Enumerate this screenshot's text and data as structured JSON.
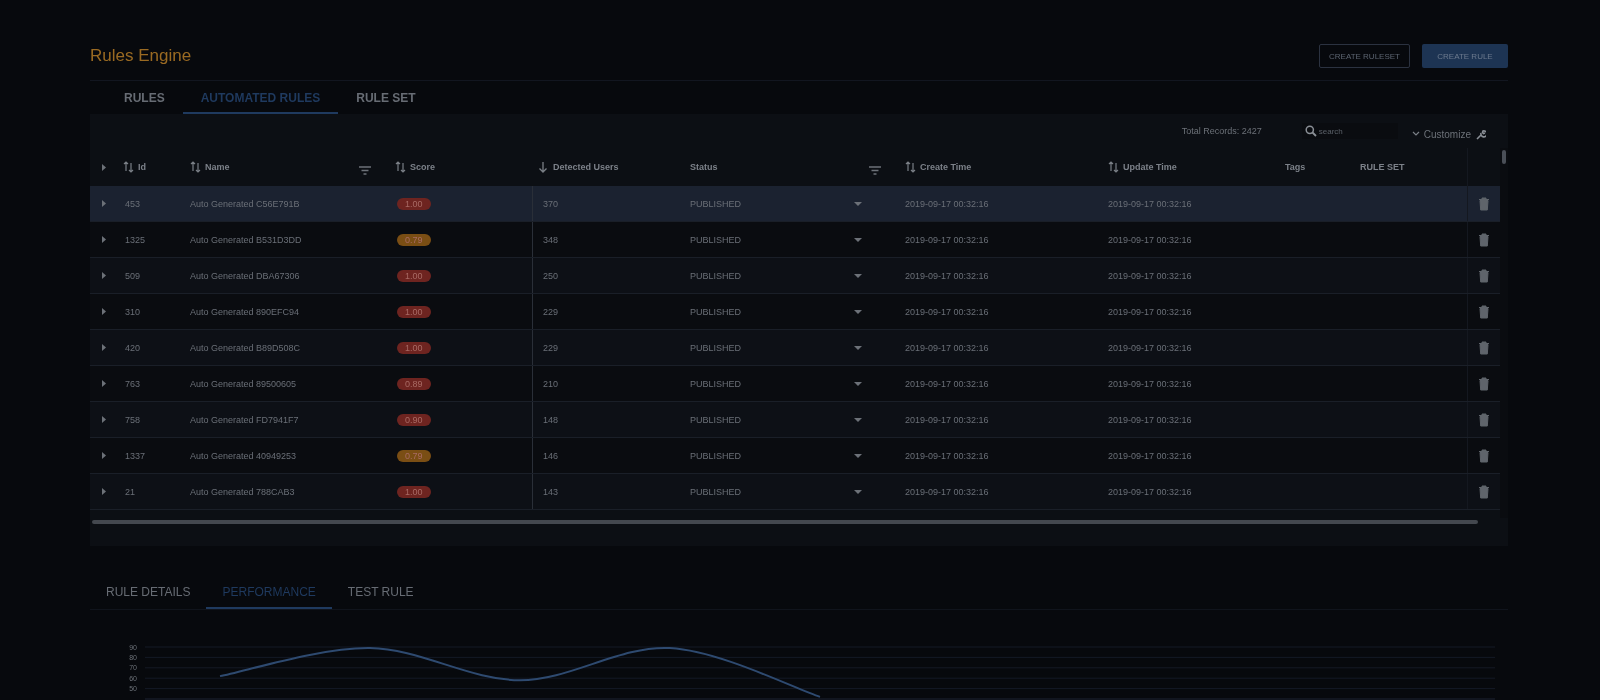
{
  "page": {
    "title": "Rules Engine",
    "buttons": [
      {
        "label": "CREATE RULESET",
        "kind": "outline"
      },
      {
        "label": "CREATE RULE",
        "kind": "primary"
      }
    ]
  },
  "tabs": [
    {
      "label": "RULES",
      "selected": false
    },
    {
      "label": "AUTOMATED RULES",
      "selected": true
    },
    {
      "label": "RULE SET",
      "selected": false
    }
  ],
  "table": {
    "total_records": "Total Records: 2427",
    "search": {
      "placeholder": "search"
    },
    "customize": "Customize",
    "columns": [
      {
        "label": "Id",
        "sortable": true,
        "sorted": false,
        "filter": false
      },
      {
        "label": "Name",
        "sortable": true,
        "sorted": false,
        "filter": true
      },
      {
        "label": "Score",
        "sortable": true,
        "sorted": false,
        "filter": false
      },
      {
        "label": "Detected Users",
        "sortable": true,
        "sorted": true,
        "filter": false
      },
      {
        "label": "Status",
        "sortable": false,
        "sorted": false,
        "filter": true
      },
      {
        "label": "Create Time",
        "sortable": true,
        "sorted": false,
        "filter": false
      },
      {
        "label": "Update Time",
        "sortable": true,
        "sorted": false,
        "filter": false
      },
      {
        "label": "Tags",
        "sortable": false,
        "sorted": false,
        "filter": false
      },
      {
        "label": "RULE SET",
        "sortable": false,
        "sorted": false,
        "filter": false
      }
    ],
    "rows": [
      {
        "id": "453",
        "name": "Auto Generated C56E791B",
        "score": "1.00",
        "color": "#6e2420",
        "detected": "370",
        "status": "PUBLISHED",
        "create": "2019-09-17 00:32:16",
        "update": "2019-09-17 00:32:16",
        "selected": true
      },
      {
        "id": "1325",
        "name": "Auto Generated B531D3DD",
        "score": "0.79",
        "color": "#7a4e14",
        "detected": "348",
        "status": "PUBLISHED",
        "create": "2019-09-17 00:32:16",
        "update": "2019-09-17 00:32:16",
        "selected": false
      },
      {
        "id": "509",
        "name": "Auto Generated DBA67306",
        "score": "1.00",
        "color": "#6e2420",
        "detected": "250",
        "status": "PUBLISHED",
        "create": "2019-09-17 00:32:16",
        "update": "2019-09-17 00:32:16",
        "selected": false
      },
      {
        "id": "310",
        "name": "Auto Generated 890EFC94",
        "score": "1.00",
        "color": "#6e2420",
        "detected": "229",
        "status": "PUBLISHED",
        "create": "2019-09-17 00:32:16",
        "update": "2019-09-17 00:32:16",
        "selected": false
      },
      {
        "id": "420",
        "name": "Auto Generated B89D508C",
        "score": "1.00",
        "color": "#6e2420",
        "detected": "229",
        "status": "PUBLISHED",
        "create": "2019-09-17 00:32:16",
        "update": "2019-09-17 00:32:16",
        "selected": false
      },
      {
        "id": "763",
        "name": "Auto Generated 89500605",
        "score": "0.89",
        "color": "#6e2420",
        "detected": "210",
        "status": "PUBLISHED",
        "create": "2019-09-17 00:32:16",
        "update": "2019-09-17 00:32:16",
        "selected": false
      },
      {
        "id": "758",
        "name": "Auto Generated FD7941F7",
        "score": "0.90",
        "color": "#6e2420",
        "detected": "148",
        "status": "PUBLISHED",
        "create": "2019-09-17 00:32:16",
        "update": "2019-09-17 00:32:16",
        "selected": false
      },
      {
        "id": "1337",
        "name": "Auto Generated 40949253",
        "score": "0.79",
        "color": "#7a4e14",
        "detected": "146",
        "status": "PUBLISHED",
        "create": "2019-09-17 00:32:16",
        "update": "2019-09-17 00:32:16",
        "selected": false
      },
      {
        "id": "21",
        "name": "Auto Generated 788CAB3",
        "score": "1.00",
        "color": "#6e2420",
        "detected": "143",
        "status": "PUBLISHED",
        "create": "2019-09-17 00:32:16",
        "update": "2019-09-17 00:32:16",
        "selected": false
      }
    ]
  },
  "detail_tabs": [
    {
      "label": "RULE DETAILS",
      "selected": false
    },
    {
      "label": "PERFORMANCE",
      "selected": true
    },
    {
      "label": "TEST RULE",
      "selected": false
    }
  ],
  "performance": {
    "chart_data": {
      "type": "line",
      "ylim": [
        40,
        90
      ],
      "yticks": [
        50,
        60,
        70,
        80,
        90
      ],
      "grid": true,
      "series": [
        {
          "color": "#2e4a70",
          "values": [
            62,
            89,
            58,
            89,
            42,
            null,
            null,
            null,
            null
          ]
        }
      ]
    }
  }
}
